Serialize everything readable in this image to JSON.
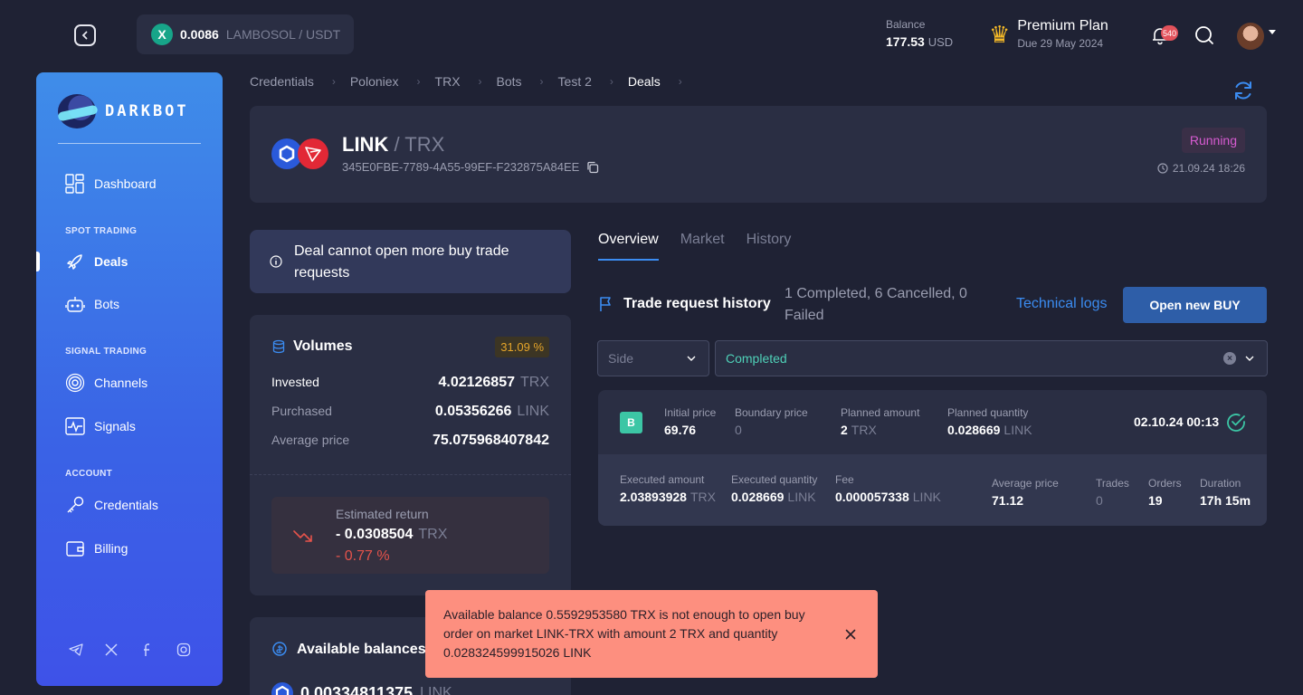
{
  "topbar": {
    "ticker_price": "0.0086",
    "ticker_pair": "LAMBOSOL / USDT",
    "balance_label": "Balance",
    "balance_value": "177.53",
    "balance_currency": "USD",
    "plan_title": "Premium Plan",
    "plan_due": "Due 29 May 2024",
    "notification_count": "540"
  },
  "sidebar": {
    "logo_text": "DARKBOT",
    "items": [
      {
        "label": "Dashboard"
      },
      {
        "label": "Deals"
      },
      {
        "label": "Bots"
      },
      {
        "label": "Channels"
      },
      {
        "label": "Signals"
      },
      {
        "label": "Credentials"
      },
      {
        "label": "Billing"
      }
    ],
    "sections": [
      "SPOT TRADING",
      "SIGNAL TRADING",
      "ACCOUNT"
    ]
  },
  "breadcrumb": [
    "Credentials",
    "Poloniex",
    "TRX",
    "Bots",
    "Test 2",
    "Deals"
  ],
  "deal": {
    "base": "LINK",
    "quote": "/ TRX",
    "id": "345E0FBE-7789-4A55-99EF-F232875A84EE",
    "status": "Running",
    "status_color": "#d75bd1",
    "created": "21.09.24 18:26"
  },
  "warning": "Deal cannot open more buy trade requests",
  "volumes": {
    "title": "Volumes",
    "percent": "31.09 %",
    "invested_label": "Invested",
    "invested_value": "4.02126857",
    "invested_unit": "TRX",
    "purchased_label": "Purchased",
    "purchased_value": "0.05356266",
    "purchased_unit": "LINK",
    "avg_label": "Average price",
    "avg_value": "75.075968407842",
    "est_label": "Estimated return",
    "est_value": "- 0.0308504",
    "est_unit": "TRX",
    "est_pct": "- 0.77 %"
  },
  "available": {
    "title": "Available balances",
    "value": "0.00334811375",
    "unit": "LINK"
  },
  "tabs": [
    "Overview",
    "Market",
    "History"
  ],
  "trade_history": {
    "title": "Trade request history",
    "summary": "1 Completed, 6 Cancelled, 0 Failed",
    "tech_logs": "Technical logs",
    "open_buy": "Open new BUY",
    "side_placeholder": "Side",
    "status_filter": "Completed"
  },
  "trade": {
    "side": "B",
    "initial_price_label": "Initial price",
    "initial_price": "69.76",
    "boundary_label": "Boundary price",
    "boundary": "0",
    "planned_amount_label": "Planned amount",
    "planned_amount": "2",
    "planned_amount_unit": "TRX",
    "planned_qty_label": "Planned quantity",
    "planned_qty": "0.028669",
    "planned_qty_unit": "LINK",
    "date": "02.10.24 00:13",
    "exec_amount_label": "Executed amount",
    "exec_amount": "2.03893928",
    "exec_amount_unit": "TRX",
    "exec_qty_label": "Executed quantity",
    "exec_qty": "0.028669",
    "exec_qty_unit": "LINK",
    "fee_label": "Fee",
    "fee": "0.000057338",
    "fee_unit": "LINK",
    "avg_label": "Average price",
    "avg": "71.12",
    "trades_label": "Trades",
    "trades": "0",
    "orders_label": "Orders",
    "orders": "19",
    "duration_label": "Duration",
    "duration": "17h 15m"
  },
  "toast": "Available balance 0.5592953580 TRX is not enough to open buy order on market LINK-TRX with amount 2 TRX and quantity 0.028324599915026 LINK"
}
